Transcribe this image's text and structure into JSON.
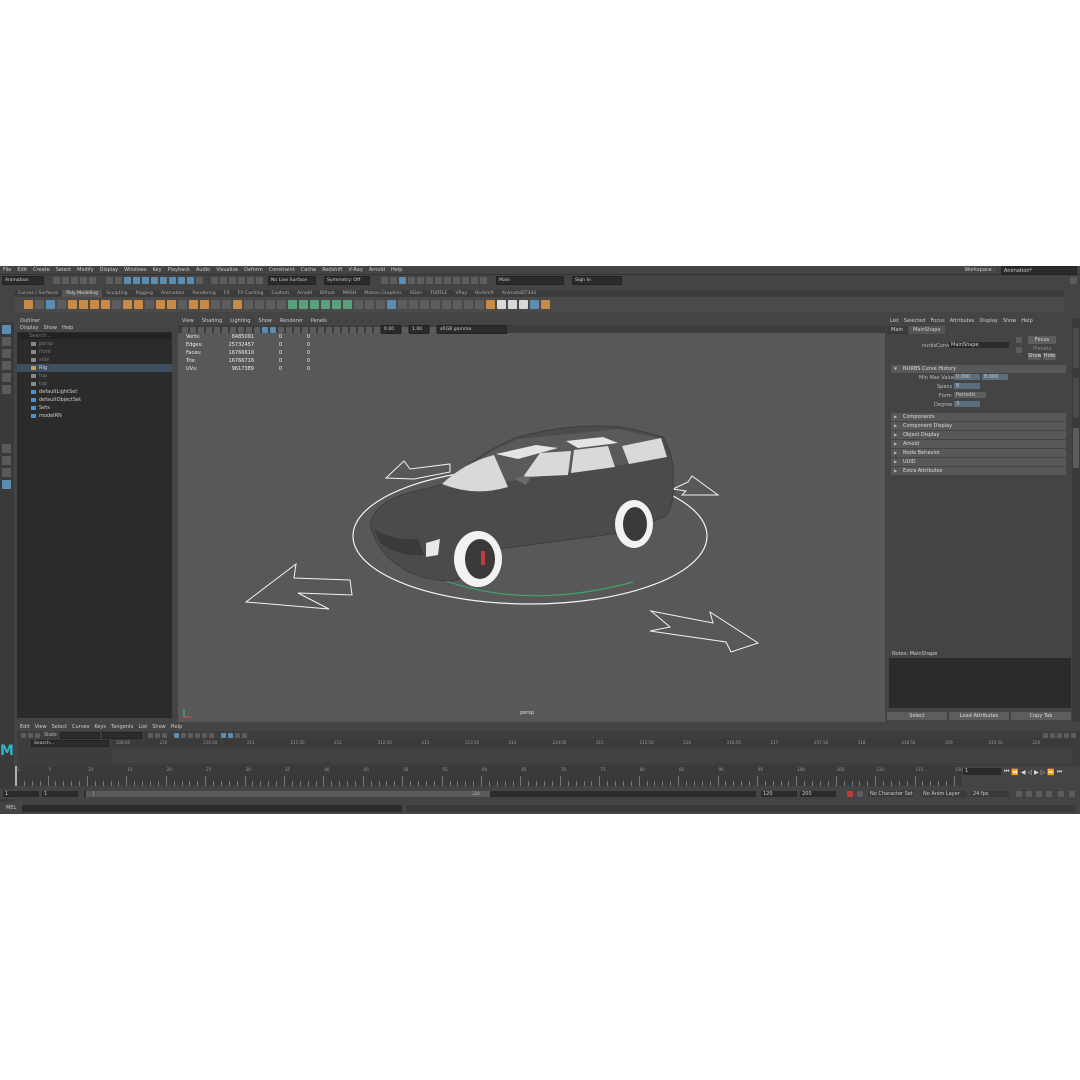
{
  "menu_bar": {
    "items": [
      "File",
      "Edit",
      "Create",
      "Select",
      "Modify",
      "Display",
      "Windows",
      "Key",
      "Playback",
      "Audio",
      "Visualize",
      "Deform",
      "Constraint",
      "Cache",
      "Redshift",
      "V-Ray",
      "Arnold",
      "Help"
    ],
    "workspace_label": "Workspace :",
    "workspace_value": "Animation*"
  },
  "status_line": {
    "menu_set": "Animation",
    "live_surface": "No Live Surface",
    "symmetry": "Symmetry: Off",
    "search_value": "Main",
    "sign_in": "Sign In"
  },
  "shelf": {
    "tabs": [
      "Curves / Surfaces",
      "Poly Modeling",
      "Sculpting",
      "Rigging",
      "Animation",
      "Rendering",
      "FX",
      "FX Caching",
      "Custom",
      "Arnold",
      "Bifrost",
      "MASH",
      "Motion Graphics",
      "XGen",
      "TURTLE",
      "VRay",
      "Redshift",
      "AnimateDT344"
    ],
    "active_tab": "Poly Modeling"
  },
  "outliner": {
    "title": "Outliner",
    "menu": [
      "Display",
      "Show",
      "Help"
    ],
    "search_placeholder": "Search...",
    "items": [
      {
        "label": "persp",
        "dim": true
      },
      {
        "label": "front",
        "dim": true
      },
      {
        "label": "side",
        "dim": true
      },
      {
        "label": "Rig",
        "dim": false,
        "selected": true
      },
      {
        "label": "top",
        "dim": true
      },
      {
        "label": "top",
        "dim": true
      },
      {
        "label": "defaultLightSet",
        "dim": false
      },
      {
        "label": "defaultObjectSet",
        "dim": false
      },
      {
        "label": "Sets",
        "dim": false
      },
      {
        "label": "modelRN",
        "dim": false
      }
    ]
  },
  "viewport": {
    "menu": [
      "View",
      "Shading",
      "Lighting",
      "Show",
      "Renderer",
      "Panels"
    ],
    "exposure": "0.00",
    "gamma": "1.00",
    "color_space": "sRGB gamma",
    "camera_label": "persp",
    "hud": [
      {
        "label": "Verts:",
        "a": "8485091",
        "b": "0",
        "c": "0"
      },
      {
        "label": "Edges:",
        "a": "25732457",
        "b": "0",
        "c": "0"
      },
      {
        "label": "Faces:",
        "a": "16766610",
        "b": "0",
        "c": "0"
      },
      {
        "label": "Tris:",
        "a": "16766716",
        "b": "0",
        "c": "0"
      },
      {
        "label": "UVs:",
        "a": "9617389",
        "b": "0",
        "c": "0"
      }
    ]
  },
  "attribute_editor": {
    "menu": [
      "List",
      "Selected",
      "Focus",
      "Attributes",
      "Display",
      "Show",
      "Help"
    ],
    "tabs": [
      "Main",
      "MainShape"
    ],
    "active_tab": "MainShape",
    "node_type_label": "nurbsCurve:",
    "node_name": "MainShape",
    "focus_label": "Focus",
    "presets_label": "Presets",
    "show_label": "Show",
    "hide_label": "Hide",
    "open_section": "NURBS Curve History",
    "fields": {
      "min_max_label": "Min Max Value",
      "min_value": "0.000",
      "max_value": "8.000",
      "spans_label": "Spans",
      "spans_value": "8",
      "form_label": "Form",
      "form_value": "Periodic",
      "degree_label": "Degree",
      "degree_value": "3"
    },
    "sections": [
      "Components",
      "Component Display",
      "Object Display",
      "Arnold",
      "Node Behavior",
      "UUID",
      "Extra Attributes"
    ],
    "notes_label": "Notes: MainShape",
    "buttons": [
      "Select",
      "Load Attributes",
      "Copy Tab"
    ]
  },
  "graph_editor": {
    "menu": [
      "Edit",
      "View",
      "Select",
      "Curves",
      "Keys",
      "Tangents",
      "List",
      "Show",
      "Help"
    ],
    "stats_label": "Stats",
    "search_placeholder": "Search...",
    "ruler": [
      "208.00",
      "210",
      "210.50",
      "211",
      "211.50",
      "212",
      "212.50",
      "213",
      "213.50",
      "214",
      "214.50",
      "215",
      "215.50",
      "216",
      "216.50",
      "217",
      "217.50",
      "218",
      "218.50",
      "219",
      "219.50",
      "220"
    ]
  },
  "timeline": {
    "ticks": [
      "1",
      "5",
      "10",
      "15",
      "20",
      "25",
      "30",
      "35",
      "40",
      "45",
      "50",
      "55",
      "60",
      "65",
      "70",
      "75",
      "80",
      "85",
      "90",
      "95",
      "100",
      "105",
      "110",
      "115",
      "120"
    ],
    "current_frame": "1"
  },
  "range_slider": {
    "start": "1",
    "inner_start": "1",
    "range_start_label": "1",
    "range_end_label": "120",
    "end": "120",
    "total": "200",
    "character_set": "No Character Set",
    "anim_layer": "No Anim Layer",
    "fps": "24 fps"
  },
  "command_line": {
    "label": "MEL"
  },
  "colors": {
    "accent": "#5b8cb2",
    "panel_bg": "#444444",
    "dark_bg": "#2b2b2b",
    "viewport_bg": "#585858",
    "manipulator_green": "#3fa36b",
    "selection_white": "#f0f0f0"
  }
}
